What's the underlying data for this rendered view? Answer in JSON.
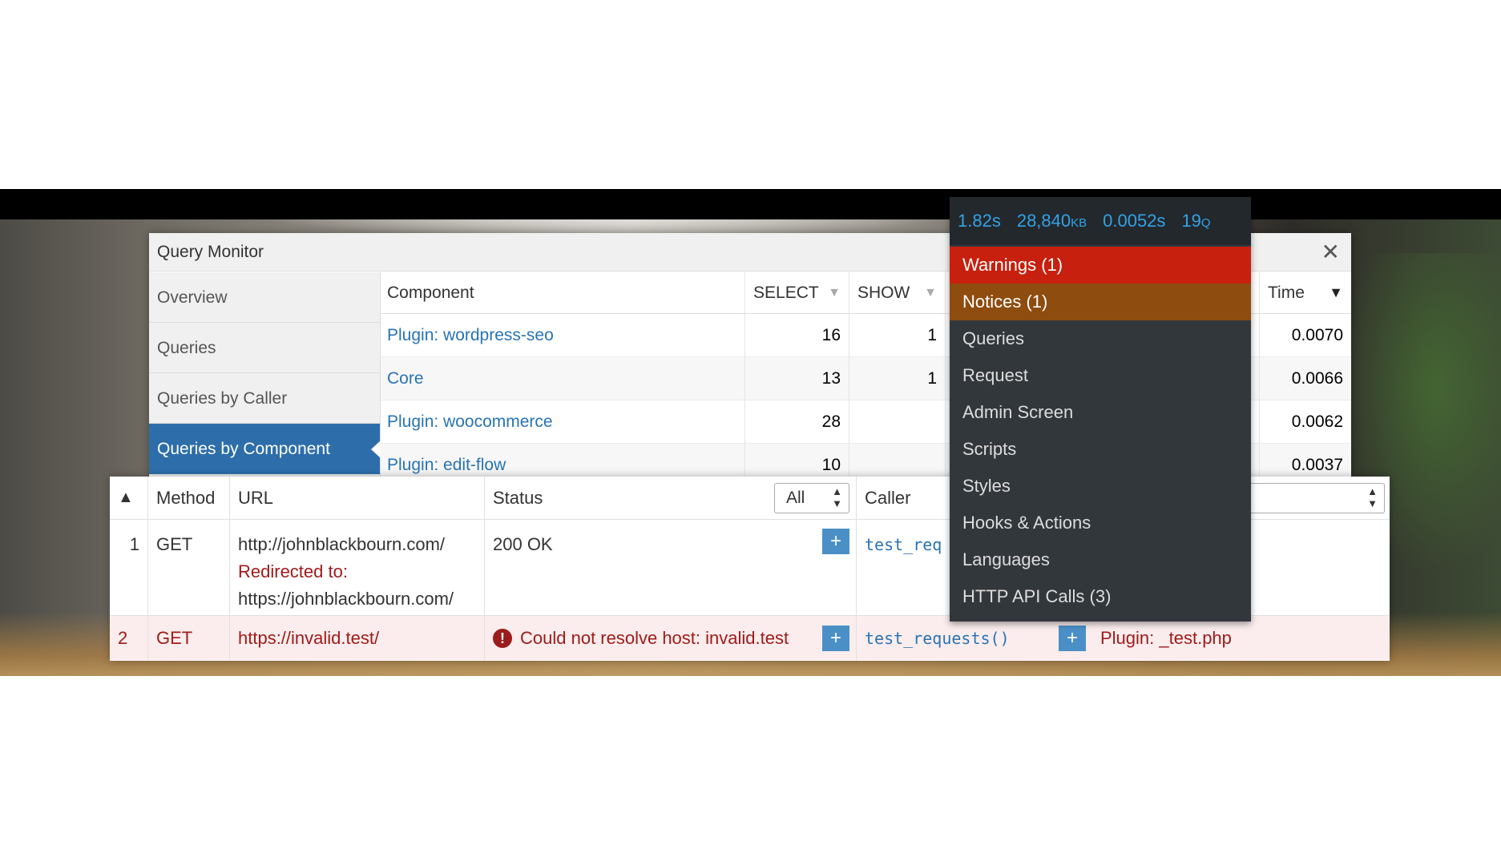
{
  "panel": {
    "title": "Query Monitor",
    "close_icon": "close-icon",
    "nav": [
      "Overview",
      "Queries",
      "Queries by Caller",
      "Queries by Component"
    ],
    "active_nav": "Queries by Component"
  },
  "components_table": {
    "headers": {
      "component": "Component",
      "select": "SELECT",
      "show": "SHOW",
      "time": "Time"
    },
    "rows": [
      {
        "name": "Plugin: wordpress-seo",
        "select": "16",
        "show": "1",
        "time": "0.0070"
      },
      {
        "name": "Core",
        "select": "13",
        "show": "1",
        "time": "0.0066"
      },
      {
        "name": "Plugin: woocommerce",
        "select": "28",
        "show": "",
        "time": "0.0062"
      },
      {
        "name": "Plugin: edit-flow",
        "select": "10",
        "show": "",
        "time": "0.0037"
      }
    ]
  },
  "http_calls": {
    "headers": {
      "method": "Method",
      "url": "URL",
      "status": "Status",
      "caller": "Caller"
    },
    "status_filter": "All",
    "rows": [
      {
        "num": "1",
        "method": "GET",
        "url": "http://johnblackbourn.com/",
        "redirect_label": "Redirected to:",
        "redirect_url": "https://johnblackbourn.com/",
        "status": "200 OK",
        "caller": "test_req"
      },
      {
        "num": "2",
        "method": "GET",
        "url": "https://invalid.test/",
        "status": "Could not resolve host: invalid.test",
        "caller": "test_requests()",
        "component": "Plugin: _test.php"
      }
    ]
  },
  "admin_bar": {
    "stats": {
      "time": "1.82s",
      "memory": "28,840",
      "memory_unit": "KB",
      "query_time": "0.0052s",
      "queries": "19",
      "queries_unit": "Q"
    },
    "menu": [
      "Warnings (1)",
      "Notices (1)",
      "Queries",
      "Request",
      "Admin Screen",
      "Scripts",
      "Styles",
      "Hooks & Actions",
      "Languages",
      "HTTP API Calls (3)"
    ]
  },
  "colors": {
    "accent": "#2d6eaa",
    "link": "#2873b5",
    "warning": "#c8200e",
    "notice": "#8e4c0e",
    "stats": "#32a3e6",
    "error_row": "#fbeded"
  }
}
